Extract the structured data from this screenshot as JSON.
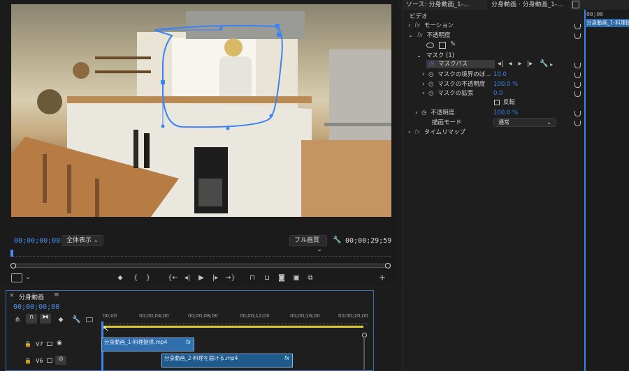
{
  "program": {
    "timecode_current": "00;00;00;00",
    "zoom_select": "全体表示",
    "quality_select": "フル画質",
    "timecode_duration": "00;00;29;59"
  },
  "panel_tabs": {
    "source": "ソース: 分身動画_1-...",
    "effect_controls": "分身動画 · 分身動画_1-..."
  },
  "effect_controls": {
    "section": "ビデオ",
    "motion": "モーション",
    "opacity": "不透明度",
    "mask": "マスク (1)",
    "mask_path": "マスクパス",
    "mask_feather_label": "マスクの境界のぼ...",
    "mask_feather_value": "10.0",
    "mask_opacity_label": "マスクの不透明度",
    "mask_opacity_value": "100.0 %",
    "mask_expansion_label": "マスクの拡張",
    "mask_expansion_value": "0.0",
    "inverted_label": "反転",
    "opacity_label": "不透明度",
    "opacity_value": "100.0 %",
    "blend_label": "描画モード",
    "blend_value": "通常",
    "time_remap": "タイムリマップ",
    "fx_label": "fx"
  },
  "fx_timeline": {
    "ruler": "00;00",
    "clip": "分身動画_1-料理提"
  },
  "timeline": {
    "title": "分身動画",
    "timecode": "00;00;00;00",
    "ruler": [
      "00;00",
      "00;00;04;00",
      "00;00;08;00",
      "00;00;12;00",
      "00;00;16;00",
      "00;00;20;00"
    ],
    "tracks": [
      {
        "name": "V7",
        "clip": "分身動画_1-料理提供.mp4",
        "fx": "fx"
      },
      {
        "name": "V6",
        "clip": "分身動画_2-料理を届ける.mp4",
        "fx": "fx"
      }
    ]
  },
  "colors": {
    "accent_blue": "#3b83f0",
    "playhead_blue": "#4a8df0",
    "clip_blue": "#2d6aa8"
  }
}
